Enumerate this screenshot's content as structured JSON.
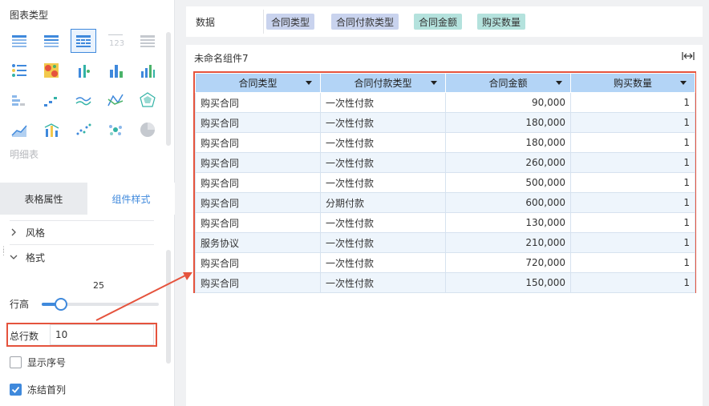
{
  "left_panel": {
    "section_title": "图表类型",
    "chart_types": [
      {
        "icon": "table-group-icon"
      },
      {
        "icon": "table-cross-icon"
      },
      {
        "icon": "table-detail-icon",
        "active": true
      },
      {
        "icon": "number-card-icon"
      },
      {
        "icon": "text-table-icon"
      },
      {
        "icon": "dot-matrix-icon"
      },
      {
        "icon": "heatmap-icon"
      },
      {
        "icon": "scatter-column-icon"
      },
      {
        "icon": "stacked-bar-icon"
      },
      {
        "icon": "column-chart-icon"
      },
      {
        "icon": "dash-bar-icon"
      },
      {
        "icon": "step-area-icon"
      },
      {
        "icon": "multi-line-icon"
      },
      {
        "icon": "crossing-line-icon"
      },
      {
        "icon": "radar-icon"
      },
      {
        "icon": "area-line-icon"
      },
      {
        "icon": "combo-chart-icon"
      },
      {
        "icon": "scatter-dots-icon"
      },
      {
        "icon": "bubble-icon"
      },
      {
        "icon": "pie-icon"
      }
    ],
    "chart_type_hint": "明细表",
    "tabs": [
      {
        "label": "表格属性",
        "active": false
      },
      {
        "label": "组件样式",
        "active": true
      }
    ],
    "style_label": "风格",
    "format_label": "格式",
    "row_height_label": "行高",
    "row_height_value": "25",
    "row_height_fraction": 0.12,
    "total_rows_label": "总行数",
    "total_rows_value": "10",
    "show_serial_label": "显示序号",
    "show_serial_checked": false,
    "freeze_first_col_label": "冻结首列",
    "freeze_first_col_checked": true
  },
  "data_bar": {
    "label": "数据",
    "fields": [
      {
        "label": "合同类型",
        "kind": "dimension"
      },
      {
        "label": "合同付款类型",
        "kind": "dimension"
      },
      {
        "label": "合同金额",
        "kind": "measure"
      },
      {
        "label": "购买数量",
        "kind": "measure"
      }
    ]
  },
  "component": {
    "title": "未命名组件7",
    "fit_icon": "fit-width-icon",
    "columns": [
      "合同类型",
      "合同付款类型",
      "合同金额",
      "购买数量"
    ],
    "rows": [
      [
        "购买合同",
        "一次性付款",
        "90,000",
        "1"
      ],
      [
        "购买合同",
        "一次性付款",
        "180,000",
        "1"
      ],
      [
        "购买合同",
        "一次性付款",
        "180,000",
        "1"
      ],
      [
        "购买合同",
        "一次性付款",
        "260,000",
        "1"
      ],
      [
        "购买合同",
        "一次性付款",
        "500,000",
        "1"
      ],
      [
        "购买合同",
        "分期付款",
        "600,000",
        "1"
      ],
      [
        "购买合同",
        "一次性付款",
        "130,000",
        "1"
      ],
      [
        "服务协议",
        "一次性付款",
        "210,000",
        "1"
      ],
      [
        "购买合同",
        "一次性付款",
        "720,000",
        "1"
      ],
      [
        "购买合同",
        "一次性付款",
        "150,000",
        "1"
      ]
    ]
  },
  "colors": {
    "accent": "#3f89dc",
    "highlight": "#e5533d",
    "header_bg": "#b3d4f6",
    "dimension_pill": "#c9d3ee",
    "measure_pill": "#b4e2dd"
  }
}
